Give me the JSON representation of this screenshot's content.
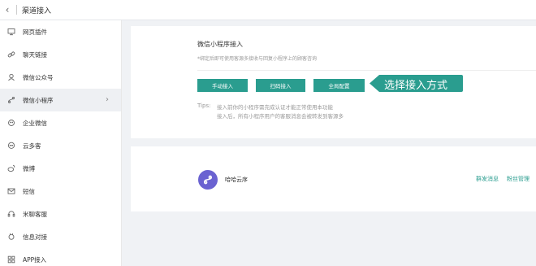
{
  "header": {
    "back_icon": "chevron-left-icon",
    "title": "渠道接入"
  },
  "sidebar": {
    "items": [
      {
        "label": "网页插件",
        "icon": "monitor-icon"
      },
      {
        "label": "聊天链接",
        "icon": "link-icon"
      },
      {
        "label": "微信公众号",
        "icon": "wechat-official-icon"
      },
      {
        "label": "微信小程序",
        "icon": "mini-program-icon",
        "active": true
      },
      {
        "label": "企业微信",
        "icon": "work-wechat-icon"
      },
      {
        "label": "云多客",
        "icon": "chat-bubble-icon"
      },
      {
        "label": "微博",
        "icon": "weibo-icon"
      },
      {
        "label": "短信",
        "icon": "mail-icon"
      },
      {
        "label": "米聊客服",
        "icon": "headset-icon"
      },
      {
        "label": "信息对接",
        "icon": "plug-icon"
      },
      {
        "label": "APP接入",
        "icon": "app-icon"
      }
    ]
  },
  "access_card": {
    "title": "微信小程序接入",
    "subtitle": "*绑定后即可使用客源多接收与回复小程序上的顾客咨询",
    "buttons": {
      "manual": "手动接入",
      "scan": "扫码接入",
      "global": "全局配置"
    },
    "tips_label": "Tips:",
    "tips": [
      "接入前你的小程序需完成认证才能正常使用本功能",
      "接入后，所有小程序用户的客服消息会被转发到客源多"
    ]
  },
  "callout": {
    "text": "选择接入方式",
    "color": "#2a9d8f"
  },
  "app_card": {
    "name": "哈哈云序",
    "logo_icon": "mini-program-icon",
    "actions": {
      "broadcast": "群发消息",
      "fans": "粉丝管理"
    }
  },
  "colors": {
    "accent": "#2a9d8f",
    "logo": "#6a62d1"
  }
}
